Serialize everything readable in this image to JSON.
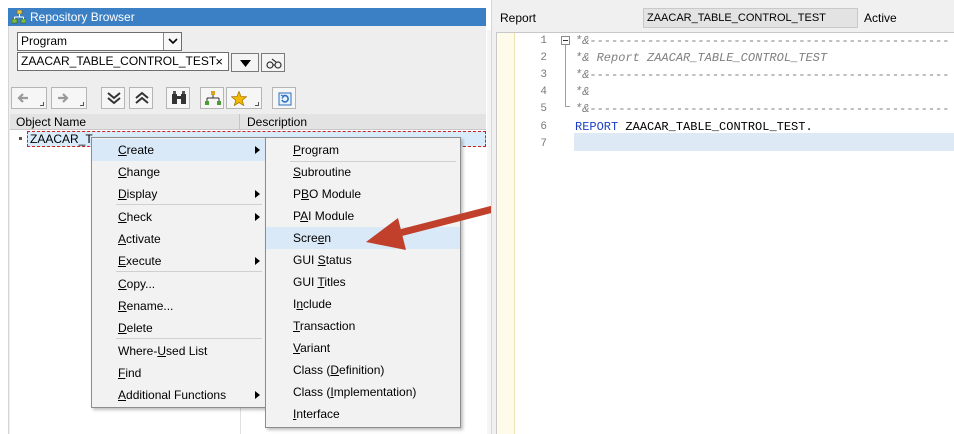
{
  "repository_browser": {
    "title": "Repository Browser",
    "object_type": "Program",
    "object_name": "ZAACAR_TABLE_CONTROL_TEST",
    "clear_glyph": "×",
    "toolbar_icons": [
      "back-icon",
      "forward-icon",
      "expand-all-icon",
      "collapse-all-icon",
      "binoculars-icon",
      "hierarchy-icon",
      "favorites-icon",
      "refresh-icon"
    ],
    "columns": {
      "object_name": "Object Name",
      "description": "Description"
    },
    "tree_row_label": "ZAACAR_T"
  },
  "context_menu": {
    "items": [
      {
        "label": "Create",
        "mnemonic_index": 0,
        "has_submenu": true,
        "highlighted": true
      },
      {
        "label": "Change",
        "mnemonic_index": 0,
        "has_submenu": false
      },
      {
        "label": "Display",
        "mnemonic_index": 0,
        "has_submenu": true
      },
      {
        "label": "Check",
        "mnemonic_index": 0,
        "has_submenu": true
      },
      {
        "label": "Activate",
        "mnemonic_index": 0,
        "has_submenu": false
      },
      {
        "label": "Execute",
        "mnemonic_index": 0,
        "has_submenu": true
      },
      {
        "label": "Copy...",
        "mnemonic_index": 0,
        "has_submenu": false
      },
      {
        "label": "Rename...",
        "mnemonic_index": 0,
        "has_submenu": false
      },
      {
        "label": "Delete",
        "mnemonic_index": 0,
        "has_submenu": false
      },
      {
        "label": "Where-Used List",
        "mnemonic_index": 6,
        "has_submenu": false
      },
      {
        "label": "Find",
        "mnemonic_index": 0,
        "has_submenu": false
      },
      {
        "label": "Additional Functions",
        "mnemonic_index": 0,
        "has_submenu": true
      }
    ]
  },
  "create_submenu": {
    "items": [
      {
        "label": "Program",
        "mnemonic_index": 0
      },
      {
        "label": "Subroutine",
        "mnemonic_index": 0
      },
      {
        "label": "PBO Module",
        "mnemonic_index": 1
      },
      {
        "label": "PAI Module",
        "mnemonic_index": 1
      },
      {
        "label": "Screen",
        "mnemonic_index": 4,
        "highlighted": true
      },
      {
        "label": "GUI Status",
        "mnemonic_index": 4
      },
      {
        "label": "GUI Titles",
        "mnemonic_index": 4
      },
      {
        "label": "Include",
        "mnemonic_index": 1
      },
      {
        "label": "Transaction",
        "mnemonic_index": 0
      },
      {
        "label": "Variant",
        "mnemonic_index": 0
      },
      {
        "label": "Class (Definition)",
        "mnemonic_index": 7
      },
      {
        "label": "Class (Implementation)",
        "mnemonic_index": 7
      },
      {
        "label": "Interface",
        "mnemonic_index": 0
      }
    ]
  },
  "editor": {
    "object_kind": "Report",
    "object_name": "ZAACAR_TABLE_CONTROL_TEST",
    "status": "Active",
    "lines": [
      {
        "num": "1",
        "text": "*&---------------------------------------------------------------------",
        "kind": "comment"
      },
      {
        "num": "2",
        "text": "*& Report ZAACAR_TABLE_CONTROL_TEST",
        "kind": "comment"
      },
      {
        "num": "3",
        "text": "*&---------------------------------------------------------------------",
        "kind": "comment"
      },
      {
        "num": "4",
        "text": "*&",
        "kind": "comment"
      },
      {
        "num": "5",
        "text": "*&---------------------------------------------------------------------",
        "kind": "comment"
      },
      {
        "num": "6",
        "keyword": "REPORT",
        "text": " ZAACAR_TABLE_CONTROL_TEST.",
        "kind": "statement"
      },
      {
        "num": "7",
        "text": "",
        "kind": "blank"
      }
    ]
  },
  "colors": {
    "titlebar": "#3b80c5",
    "menu_highlight": "#dae9f8",
    "arrow": "#c0402b",
    "keyword": "#1a3fc4",
    "comment": "#7f7f7f"
  }
}
